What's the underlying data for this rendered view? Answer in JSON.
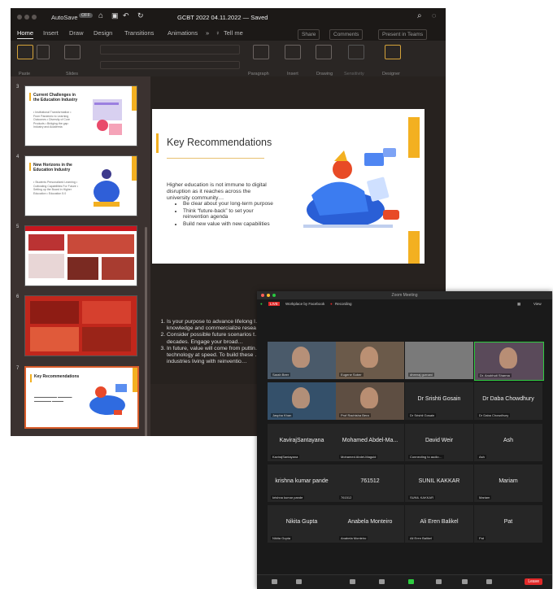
{
  "ppt": {
    "autosave": "AutoSave",
    "toggle": "OFF",
    "doc_title": "GCBT 2022 04.11.2022 — Saved",
    "tabs": [
      "Home",
      "Insert",
      "Draw",
      "Design",
      "Transitions",
      "Animations"
    ],
    "tell_me": "Tell me",
    "share": "Share",
    "comments": "Comments",
    "present": "Present in Teams",
    "ribbon": {
      "paste": "Paste",
      "slides": "Slides",
      "paragraph": "Paragraph",
      "insert": "Insert",
      "drawing": "Drawing",
      "sensitivity": "Sensitivity",
      "designer": "Designer"
    },
    "thumbnails": [
      {
        "num": "3",
        "title": "Current Challenges in the Education Industry",
        "bullets": "• Institutional Transformation • From Pandemic to Learning Outcomes • Diversity of Core Products • Bridging the gap: Industry and Academia"
      },
      {
        "num": "4",
        "title": "New Horizons in the Education Industry",
        "bullets": "• Students Personalized Learning • Cultivating Capabilities For Future • Setting up the Board in Higher Education • Education 5.0"
      },
      {
        "num": "5",
        "title": "",
        "bullets": ""
      },
      {
        "num": "6",
        "title": "",
        "bullets": ""
      },
      {
        "num": "7",
        "title": "Key Recommendations",
        "bullets": ""
      }
    ],
    "slide": {
      "title": "Key Recommendations",
      "intro": "Higher education is not immune to digital disruption as it reaches across the university community…",
      "bullets": [
        "Be clear about your long-term purpose",
        "Think “future-back” to set your reinvention agenda",
        "Build new value with new capabilities"
      ]
    },
    "notes": [
      "Is your purpose to advance lifelong l… knowledge and commercialize resea…",
      "Consider possible future scenarios t… or two decades. Engage your broad…",
      "In future, value will come from puttin… technology at speed. To build these … other industries living with reinventio…"
    ]
  },
  "zoom": {
    "window_title": "Zoom Meeting",
    "live": "LIVE",
    "live_label": "Workplace by Facebook",
    "recording": "Recording",
    "view": "View",
    "participants": [
      {
        "name": "",
        "label": "Sarah Beer",
        "video": "man"
      },
      {
        "name": "",
        "label": "Eugene Sober",
        "video": "man2"
      },
      {
        "name": "",
        "label": "dheeraj gurnani",
        "video": "blur"
      },
      {
        "name": "",
        "label": "Dr. Anubhuti Sharma",
        "video": "woman"
      },
      {
        "name": "",
        "label": "Jaspha Khan",
        "video": "man3"
      },
      {
        "name": "",
        "label": "Prof Rachisha Bera",
        "video": "man4"
      },
      {
        "name": "Dr Srishti Gosain",
        "label": "Dr Srishti Gosain",
        "video": ""
      },
      {
        "name": "Dr Daba Chowdhury",
        "label": "Dr Daba Chowdhury",
        "video": ""
      },
      {
        "name": "KavirajSantayana",
        "label": "KavirajSantayana",
        "video": ""
      },
      {
        "name": "Mohamed Abdel-Ma...",
        "label": "Mohamed Abdel-Maguid",
        "video": ""
      },
      {
        "name": "David Weir",
        "label": "Connecting to audio…",
        "video": ""
      },
      {
        "name": "Ash",
        "label": "Ash",
        "video": ""
      },
      {
        "name": "krishna kumar pande",
        "label": "krishna kumar pande",
        "video": ""
      },
      {
        "name": "761512",
        "label": "761512",
        "video": ""
      },
      {
        "name": "SUNIL KAKKAR",
        "label": "SUNIL KAKKAR",
        "video": ""
      },
      {
        "name": "Mariam",
        "label": "Mariam",
        "video": ""
      },
      {
        "name": "Nikita Gupta",
        "label": "Nikita Gupta",
        "video": ""
      },
      {
        "name": "Anabela Monteiro",
        "label": "Anabela Monteiro",
        "video": ""
      },
      {
        "name": "Ali Eren Balikel",
        "label": "Ali Eren Balikel",
        "video": ""
      },
      {
        "name": "Pat",
        "label": "Pat",
        "video": ""
      }
    ],
    "leave": "Leave"
  }
}
